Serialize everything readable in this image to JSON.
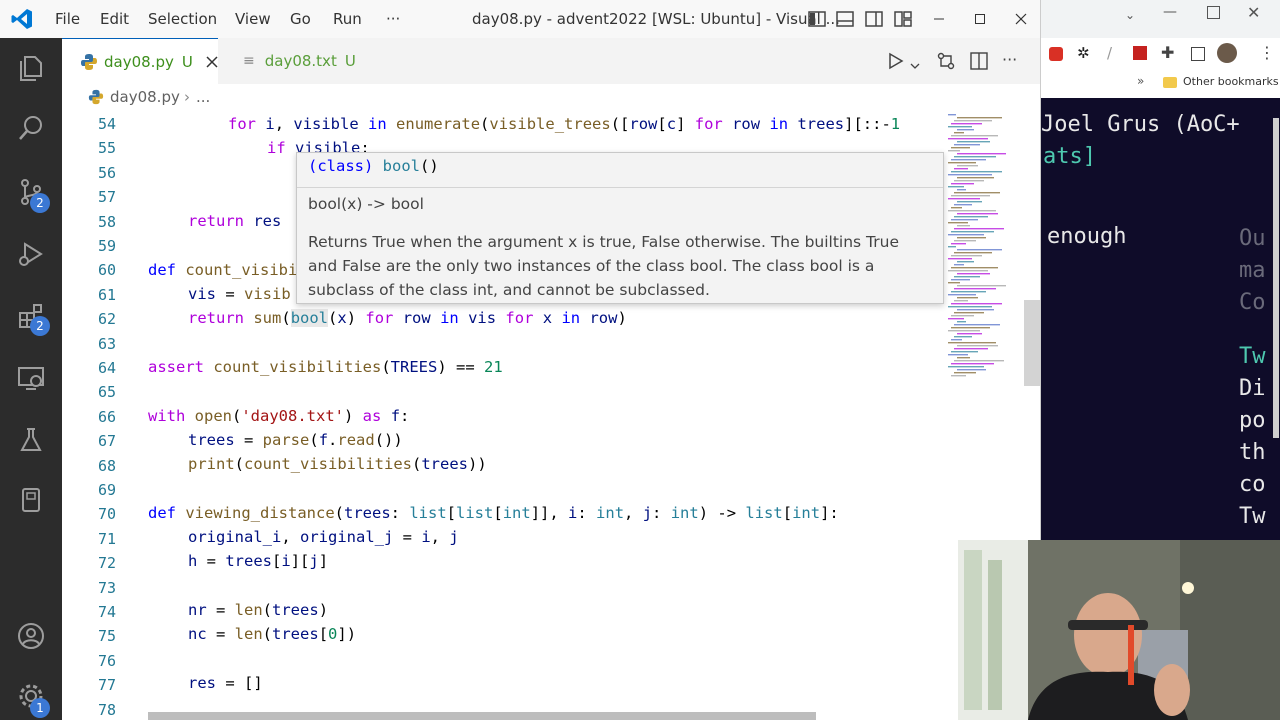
{
  "menu": [
    "File",
    "Edit",
    "Selection",
    "View",
    "Go",
    "Run",
    "···"
  ],
  "window_title": "day08.py - advent2022 [WSL: Ubuntu] - Visual ...",
  "activity_badges": {
    "scm": "2",
    "extensions": "2",
    "settings": "1"
  },
  "tabs": [
    {
      "label": "day08.py",
      "status": "U"
    },
    {
      "label": "day08.txt",
      "status": "U"
    }
  ],
  "breadcrumb": {
    "file": "day08.py",
    "rest": "..."
  },
  "line_numbers": [
    "54",
    "55",
    "56",
    "57",
    "58",
    "59",
    "60",
    "61",
    "62",
    "63",
    "64",
    "65",
    "66",
    "67",
    "68",
    "69",
    "70",
    "71",
    "72",
    "73",
    "74",
    "75",
    "76",
    "77",
    "78"
  ],
  "hover": {
    "signature_open": "(class) ",
    "signature_name": "bool",
    "signature_close": "()",
    "usage": "bool(x) -> bool",
    "doc_lines": [
      "Returns True when the argument x is true, False otherwise. The builtins True",
      "and False are the only two instances of the class bool. The class bool is a",
      "subclass of the class int, and cannot be subclassed."
    ]
  },
  "browser": {
    "bookmarks_label": "Other bookmarks",
    "lines": [
      {
        "text": "Joel Grus (AoC+",
        "color": "#e8e8e8"
      },
      {
        "text": "ats]",
        "color": "#4ec9b0"
      },
      {
        "text": "enough",
        "color": "#e8e8e8"
      },
      {
        "text": "Ou",
        "color": "#6a6a7a"
      },
      {
        "text": "ma",
        "color": "#6a6a7a"
      },
      {
        "text": "Co",
        "color": "#6a6a7a"
      },
      {
        "text": "Tw",
        "color": "#4ec9b0"
      },
      {
        "text": "Di",
        "color": "#e8e8e8"
      },
      {
        "text": "po",
        "color": "#e8e8e8"
      },
      {
        "text": "th",
        "color": "#e8e8e8"
      },
      {
        "text": "co",
        "color": "#e8e8e8"
      },
      {
        "text": "Tw",
        "color": "#e8e8e8"
      }
    ]
  },
  "colors": {
    "activity_bar": "#2c2c2c",
    "badge": "#3b78d4",
    "accent": "#007acc",
    "terminal_bg": "#0f0c29"
  }
}
